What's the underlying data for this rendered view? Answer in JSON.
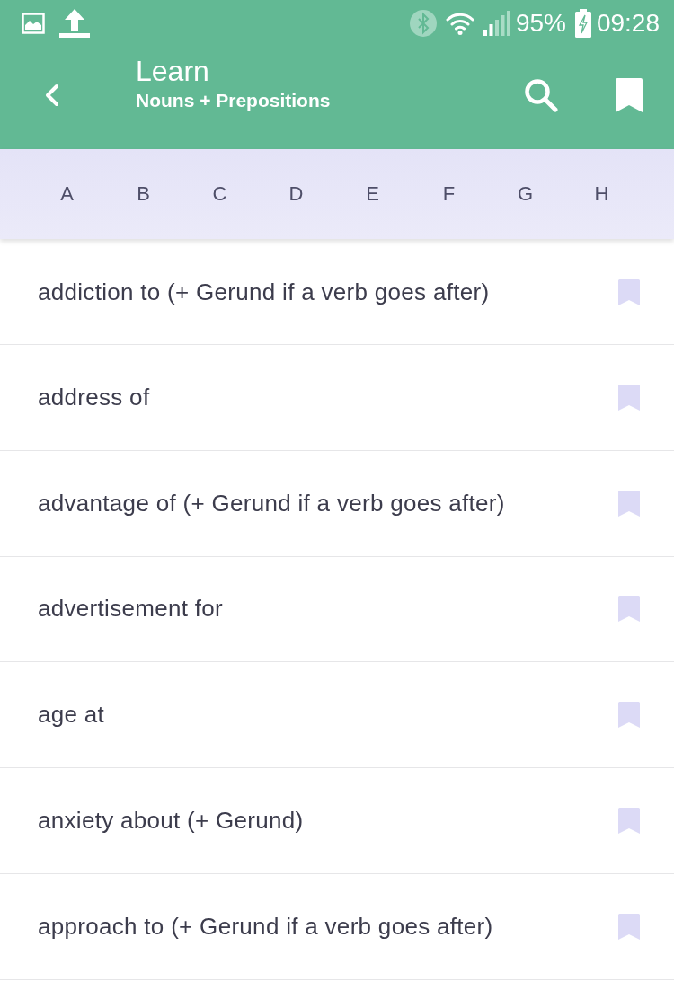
{
  "status_bar": {
    "battery": "95%",
    "time": "09:28"
  },
  "app_bar": {
    "title": "Learn",
    "subtitle": "Nouns + Prepositions"
  },
  "letters": [
    {
      "label": "A"
    },
    {
      "label": "B"
    },
    {
      "label": "C"
    },
    {
      "label": "D"
    },
    {
      "label": "E"
    },
    {
      "label": "F"
    },
    {
      "label": "G"
    },
    {
      "label": "H"
    }
  ],
  "items": [
    {
      "text": "addiction to (+ Gerund if a verb goes after)",
      "bookmarked": false
    },
    {
      "text": "address of",
      "bookmarked": false
    },
    {
      "text": "advantage of (+ Gerund if a verb goes after)",
      "bookmarked": false
    },
    {
      "text": "advertisement for",
      "bookmarked": false
    },
    {
      "text": "age at",
      "bookmarked": false
    },
    {
      "text": "anxiety about (+ Gerund)",
      "bookmarked": false
    },
    {
      "text": "approach to (+ Gerund if a verb goes after)",
      "bookmarked": false
    }
  ]
}
